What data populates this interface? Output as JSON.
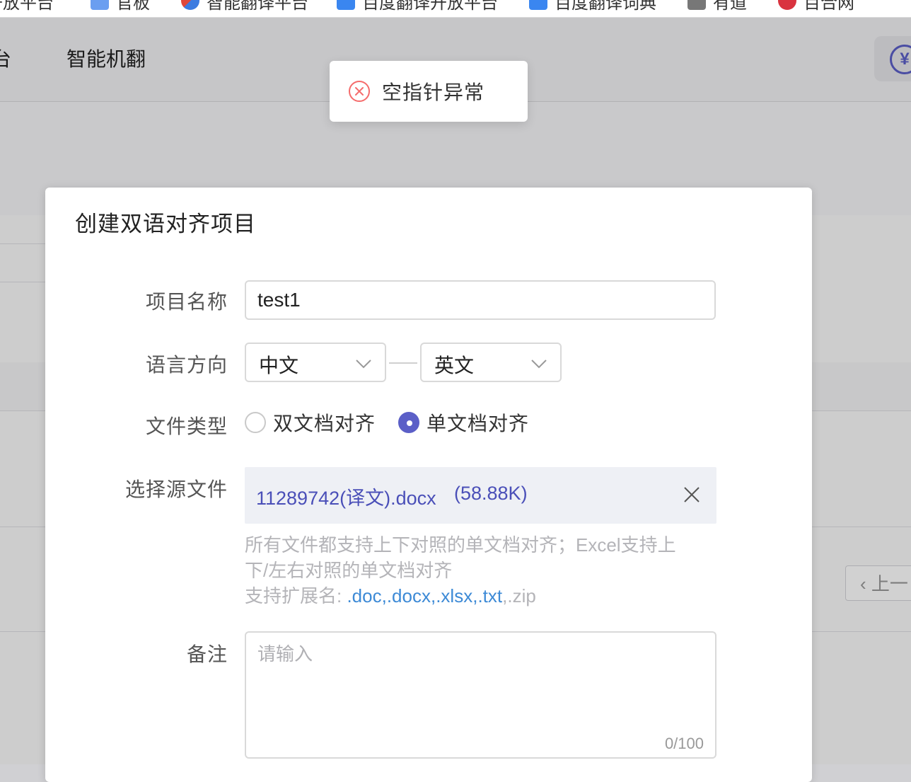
{
  "bookmarks": [
    "开放平台",
    "官板",
    "智能翻译平台",
    "百度翻译开放平台",
    "百度翻译词典",
    "有道",
    "百合网"
  ],
  "header": {
    "nav_left_fragment": "台",
    "nav_item": "智能机翻"
  },
  "background": {
    "pagination_prev": "上一"
  },
  "toast": {
    "message": "空指针异常",
    "icon": "circle-x-icon",
    "color": "#f56c6c"
  },
  "modal": {
    "title": "创建双语对齐项目",
    "form": {
      "project_name": {
        "label": "项目名称",
        "value": "test1"
      },
      "language": {
        "label": "语言方向",
        "source": "中文",
        "target": "英文"
      },
      "file_type": {
        "label": "文件类型",
        "options": [
          {
            "label": "双文档对齐",
            "checked": false
          },
          {
            "label": "单文档对齐",
            "checked": true
          }
        ]
      },
      "source_file": {
        "label": "选择源文件",
        "file_name": "11289742(译文).docx",
        "file_size": "(58.88K)",
        "hint_line1": "所有文件都支持上下对照的单文档对齐；Excel支持上",
        "hint_line2": "下/左右对照的单文档对齐",
        "ext_prefix": "支持扩展名: ",
        "extensions": [
          ".doc",
          ",.docx",
          ",.xlsx",
          ",.txt"
        ],
        "ext_disabled": ",.zip"
      },
      "remark": {
        "label": "备注",
        "placeholder": "请输入",
        "counter": "0/100"
      }
    }
  },
  "colors": {
    "accent": "#5b5fc7",
    "link": "#3d8ad6",
    "error": "#f56c6c"
  }
}
